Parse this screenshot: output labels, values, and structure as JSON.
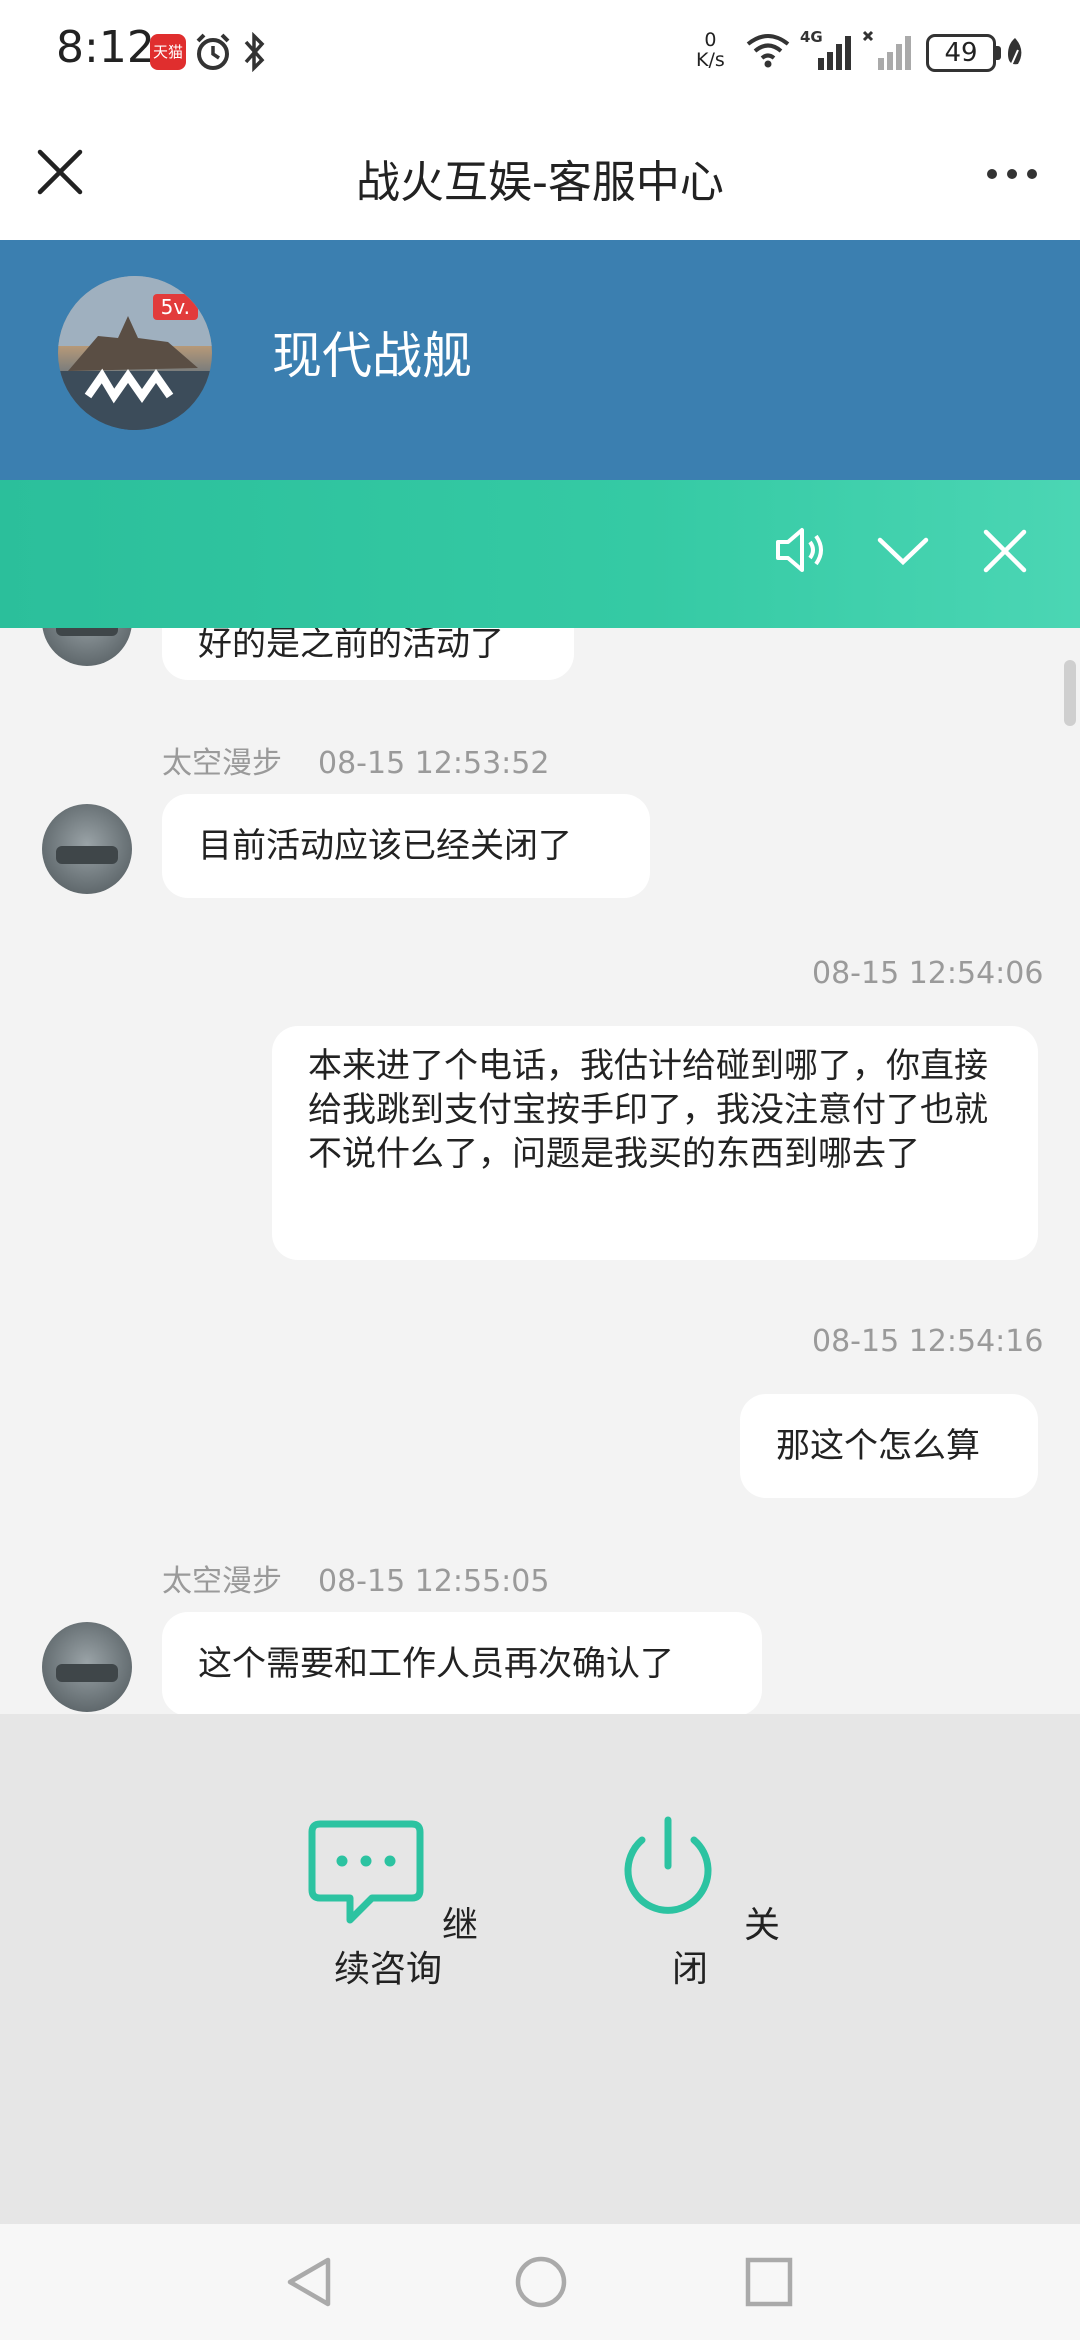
{
  "status_bar": {
    "time": "8:12",
    "app_badge": "天猫",
    "net_speed_value": "0",
    "net_speed_unit": "K/s",
    "network": "4G",
    "battery": "49"
  },
  "titlebar": {
    "title": "战火互娱-客服中心"
  },
  "header": {
    "title": "现代战舰",
    "avatar_badge": "5v."
  },
  "chat": {
    "partial_text": "好的是之前的活动了",
    "messages": [
      {
        "sender": "太空漫步",
        "time": "08-15 12:53:52",
        "text": "目前活动应该已经关闭了"
      },
      {
        "time": "08-15 12:54:06",
        "text": "本来进了个电话，我估计给碰到哪了，你直接给我跳到支付宝按手印了，我没注意付了也就不说什么了，问题是我买的东西到哪去了"
      },
      {
        "time": "08-15 12:54:16",
        "text": "那这个怎么算"
      },
      {
        "sender": "太空漫步",
        "time": "08-15 12:55:05",
        "text": "这个需要和工作人员再次确认了"
      }
    ]
  },
  "actions": {
    "continue_a": "继",
    "continue_b": "续咨询",
    "close_a": "关",
    "close_b": "闭"
  },
  "colors": {
    "header_blue": "#3b7fb0",
    "banner_green": "#35caa4",
    "accent_teal": "#2cc3a1"
  },
  "icons": {
    "close": "close-icon",
    "more": "more-dots-icon",
    "speaker": "speaker-icon",
    "collapse": "chevron-down-icon",
    "dismiss": "close-icon",
    "continue": "chat-bubble-icon",
    "power": "power-icon"
  }
}
